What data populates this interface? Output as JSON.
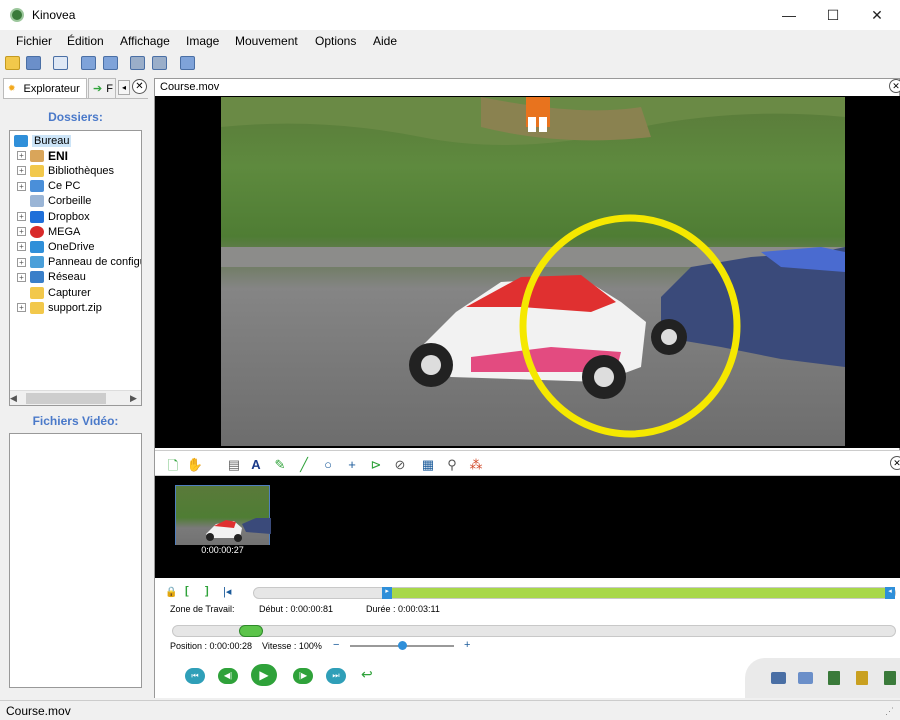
{
  "window": {
    "title": "Kinovea",
    "minimize": "—",
    "maximize": "☐",
    "close": "✕"
  },
  "menu": [
    "Fichier",
    "Édition",
    "Affichage",
    "Image",
    "Mouvement",
    "Options",
    "Aide"
  ],
  "left_panel": {
    "tab_explorer": "Explorateur",
    "tab_second": "F",
    "dossiers_title": "Dossiers:",
    "tree": [
      {
        "label": "Bureau",
        "icon": "desktop-icon",
        "expandable": false,
        "selected": true,
        "indent": 0
      },
      {
        "label": "ENI",
        "icon": "user-icon",
        "expandable": true,
        "indent": 1
      },
      {
        "label": "Bibliothèques",
        "icon": "library-icon",
        "expandable": true,
        "indent": 1
      },
      {
        "label": "Ce PC",
        "icon": "computer-icon",
        "expandable": true,
        "indent": 1
      },
      {
        "label": "Corbeille",
        "icon": "recycle-bin-icon",
        "expandable": false,
        "indent": 1
      },
      {
        "label": "Dropbox",
        "icon": "dropbox-icon",
        "expandable": true,
        "indent": 1
      },
      {
        "label": "MEGA",
        "icon": "mega-icon",
        "expandable": true,
        "indent": 1
      },
      {
        "label": "OneDrive",
        "icon": "onedrive-icon",
        "expandable": true,
        "indent": 1
      },
      {
        "label": "Panneau de configu",
        "icon": "control-panel-icon",
        "expandable": true,
        "indent": 1
      },
      {
        "label": "Réseau",
        "icon": "network-icon",
        "expandable": true,
        "indent": 1
      },
      {
        "label": "Capturer",
        "icon": "folder-icon",
        "expandable": false,
        "indent": 1
      },
      {
        "label": "support.zip",
        "icon": "zip-icon",
        "expandable": true,
        "indent": 1
      }
    ],
    "videos_title": "Fichiers Vidéo:"
  },
  "player": {
    "file_tab": "Course.mov",
    "thumbnail_time": "0:00:00:27",
    "work_zone_label": "Zone de Travail:",
    "start": "Début : 0:00:00:81",
    "duration": "Durée : 0:00:03:11",
    "position": "Position : 0:00:00:28",
    "speed": "Vitesse : 100%",
    "speed_minus": "−",
    "speed_plus": "+",
    "work_zone_fraction_start": 0.2,
    "work_zone_fraction_end": 1.0,
    "position_fraction": 0.1,
    "speed_fraction": 0.5
  },
  "status": {
    "text": "Course.mov"
  },
  "colors": {
    "accent_blue": "#4a79c9",
    "work_zone_green": "#a8d84a",
    "annotation_yellow": "#f5e800",
    "play_green": "#2fa23a"
  }
}
